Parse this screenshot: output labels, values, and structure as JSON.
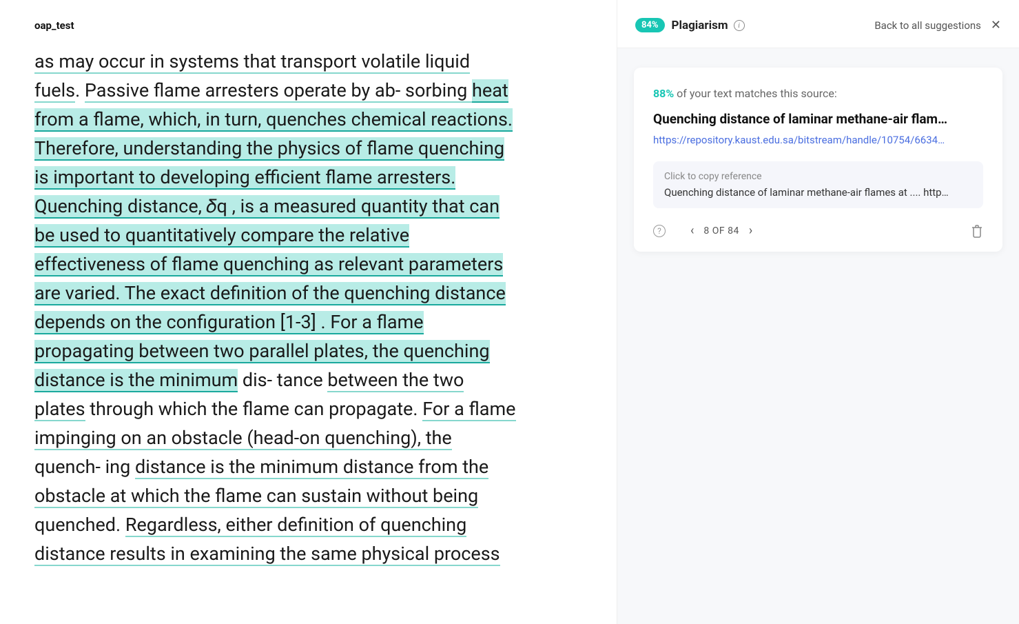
{
  "doc": {
    "title": "oap_test",
    "segments": [
      {
        "text": "as may occur in systems that transport volatile liquid fuels",
        "style": "weak"
      },
      {
        "text": ". ",
        "style": "none"
      },
      {
        "text": "Passive flame arresters operate by ab- sorbing ",
        "style": "weak"
      },
      {
        "text": "heat from a flame, which, in turn, quenches chemical reactions. Therefore, understanding the physics of flame quenching is important to developing efficient flame arresters.",
        "style": "strong"
      },
      {
        "text": "\n",
        "style": "none"
      },
      {
        "text": "Quenching distance, 𝛿q , is a measured quantity that can be used to quantitatively compare the relative effectiveness of flame quenching as relevant parameters are varied. The exact definition of the quenching distance depends on the configuration [1-3] . For a flame propagating between two parallel plates, the quenching distance is the minimum",
        "style": "strong"
      },
      {
        "text": " dis- tance ",
        "style": "none"
      },
      {
        "text": "between the two plates",
        "style": "weak"
      },
      {
        "text": " through which the flame can propagate. ",
        "style": "none"
      },
      {
        "text": "For a flame impinging on an obstacle (head-on quenching), the",
        "style": "weak"
      },
      {
        "text": " quench- ing ",
        "style": "none"
      },
      {
        "text": "distance is the minimum distance from the obstacle at which the flame can sustain without being",
        "style": "weak"
      },
      {
        "text": " quenched. ",
        "style": "none"
      },
      {
        "text": "Regardless, either definition of quenching distance results in examining the same physical process",
        "style": "weak"
      }
    ]
  },
  "panel": {
    "badge": "84%",
    "title": "Plagiarism",
    "back_link": "Back to all suggestions"
  },
  "source": {
    "match_pct": "88%",
    "match_rest": " of your text matches this source:",
    "title": "Quenching distance of laminar methane-air flam…",
    "url": "https://repository.kaust.edu.sa/bitstream/handle/10754/6634…",
    "ref_label": "Click to copy reference",
    "ref_text": "Quenching distance of laminar methane-air flames at .... http…",
    "pager": "8 OF 84"
  }
}
